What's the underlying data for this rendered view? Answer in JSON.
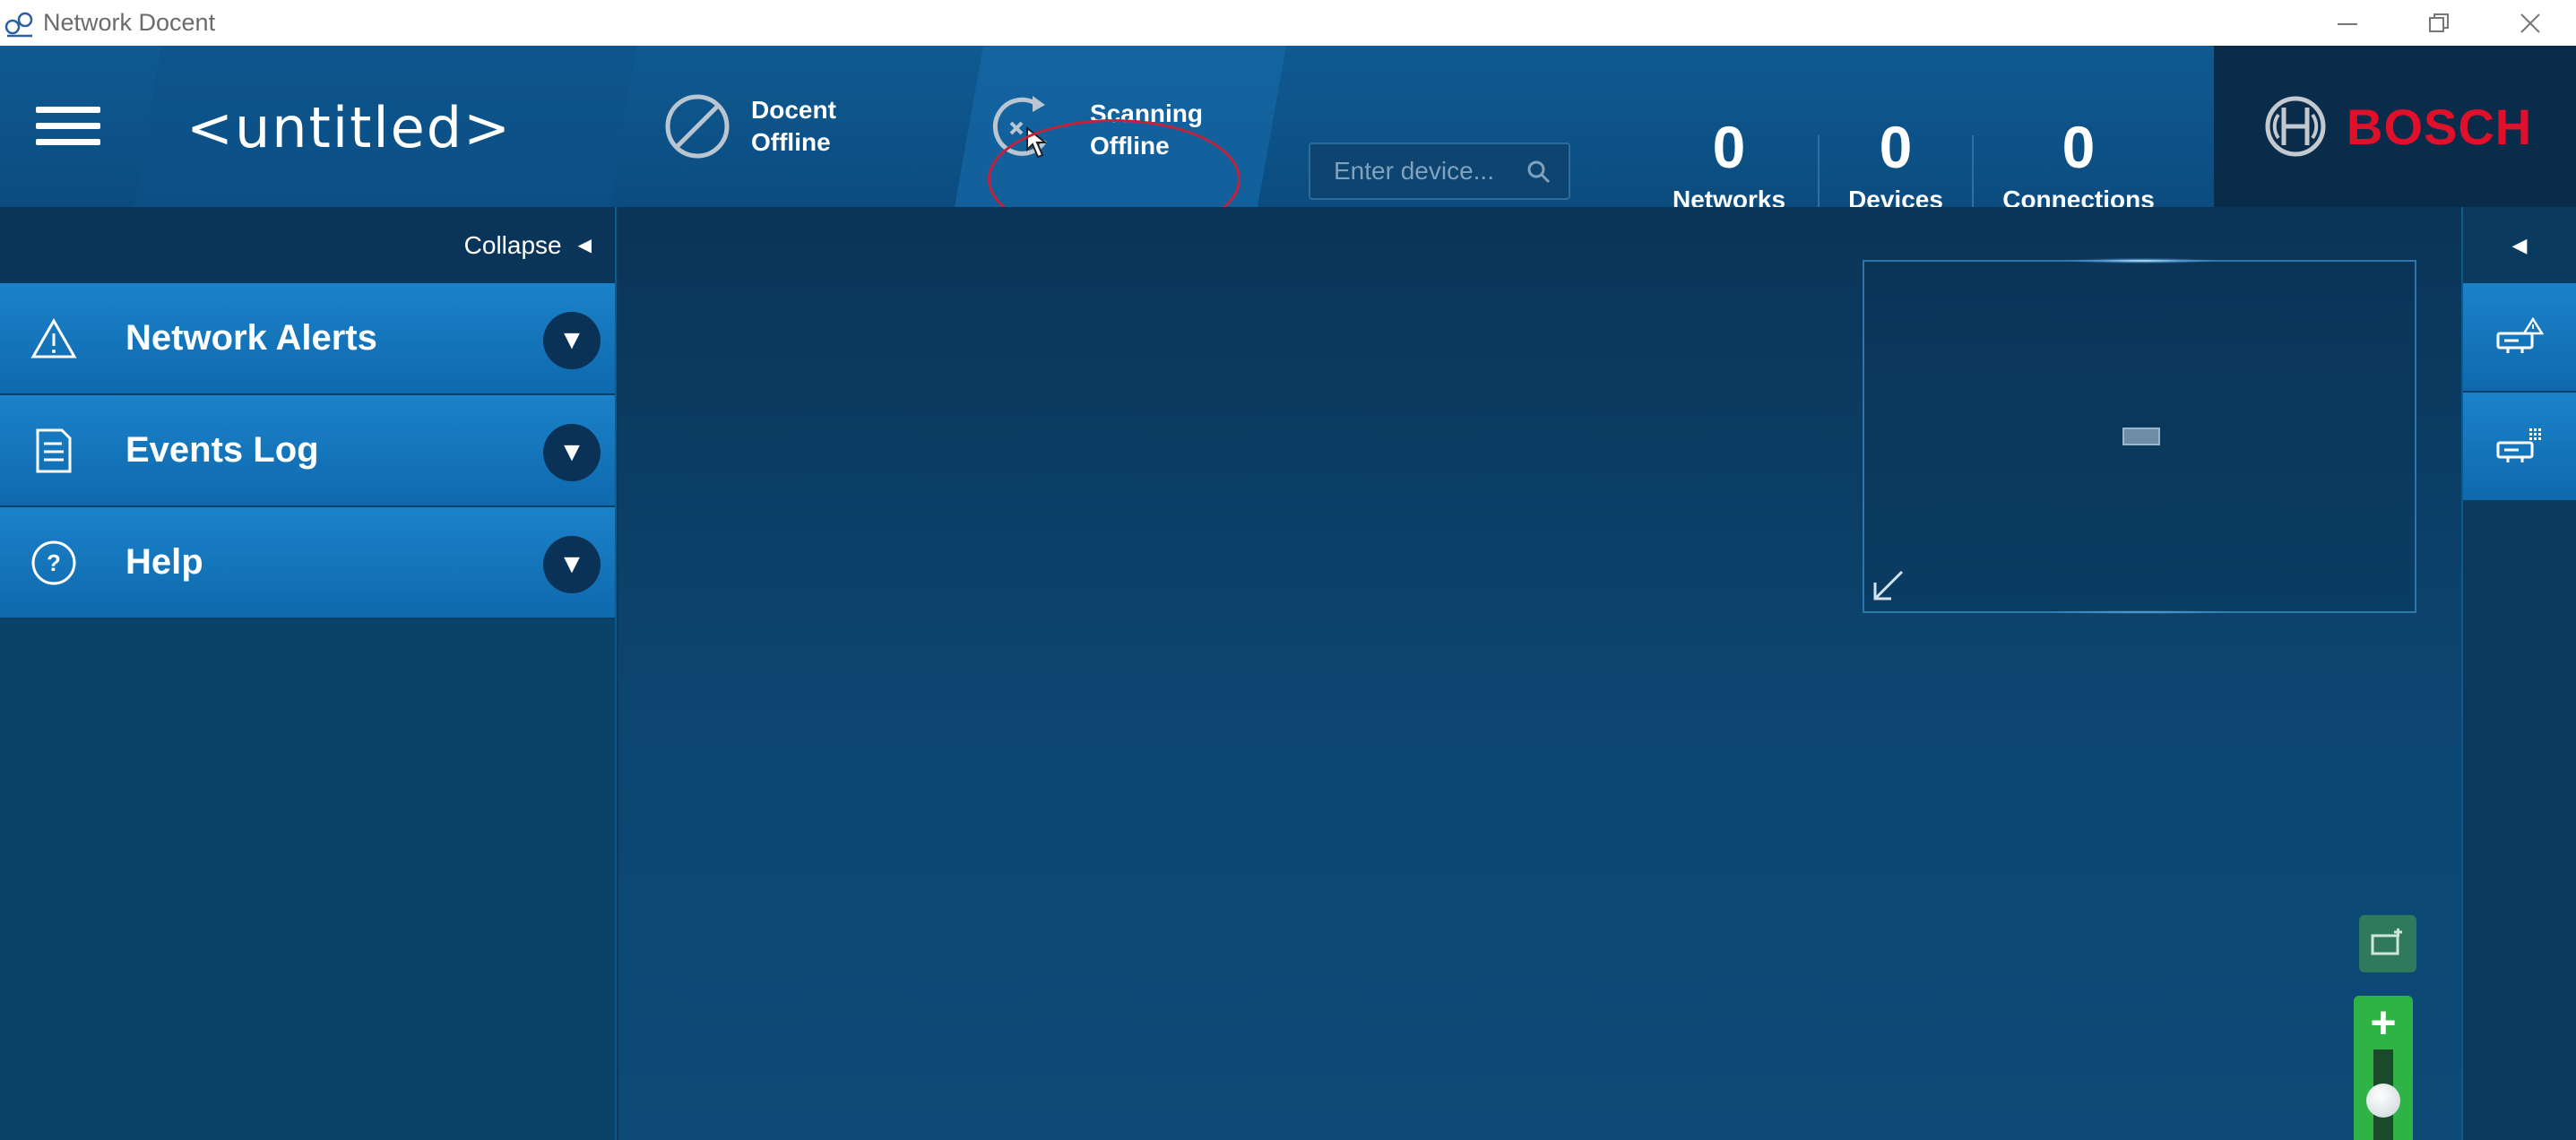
{
  "window": {
    "title": "Network Docent",
    "icon": "network-docent-app-icon",
    "controls": [
      "minimize-icon",
      "restore-icon",
      "close-icon"
    ]
  },
  "header": {
    "menu_icon": "hamburger-icon",
    "document_title": "<untitled>",
    "docent_status": {
      "line1": "Docent",
      "line2": "Offline",
      "icon": "disabled-circle-icon"
    },
    "scanning_status": {
      "line1": "Scanning",
      "line2": "Offline",
      "icon": "scan-offline-icon"
    },
    "search": {
      "placeholder": "Enter device...",
      "value": "",
      "icon": "search-icon"
    },
    "stats": [
      {
        "value": "0",
        "label": "Networks"
      },
      {
        "value": "0",
        "label": "Devices"
      },
      {
        "value": "0",
        "label": "Connections"
      }
    ],
    "brand": {
      "name": "BOSCH",
      "color": "#e0102a"
    }
  },
  "left_panel": {
    "collapse_label": "Collapse",
    "items": [
      {
        "label": "Network Alerts",
        "icon": "warning-triangle-icon"
      },
      {
        "label": "Events Log",
        "icon": "document-icon"
      },
      {
        "label": "Help",
        "icon": "help-circle-icon"
      }
    ]
  },
  "canvas": {
    "minimap": {
      "resize_icon": "resize-arrow-icon"
    },
    "fit_icon": "fit-view-icon",
    "zoom_icon": "zoom-in-icon"
  },
  "right_rail": {
    "collapse_icon": "triangle-left-icon",
    "buttons": [
      {
        "icon": "device-alert-icon"
      },
      {
        "icon": "device-grid-icon"
      }
    ]
  },
  "colors": {
    "header_bg": "#0f5a92",
    "panel_item": "#1b82c9",
    "canvas_bg": "#0c4671",
    "highlight_ring": "#c4213a",
    "zoom_green": "#2fb345"
  }
}
